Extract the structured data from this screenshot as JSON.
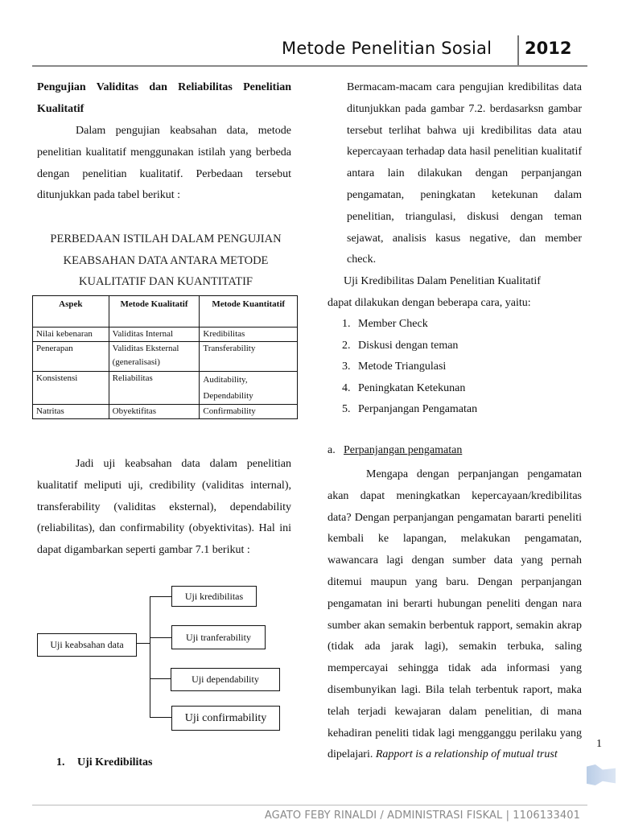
{
  "header": {
    "title": "Metode Penelitian Sosial",
    "year": "2012"
  },
  "left_column": {
    "section_title": "Pengujian Validitas dan Reliabilitas Penelitian Kualitatif",
    "intro_paragraph": "Dalam pengujian keabsahan data, metode penelitian kualitatif menggunakan istilah yang berbeda dengan penelitian kualitatif. Perbedaan tersebut ditunjukkan pada tabel berikut :",
    "table_caption": [
      "PERBEDAAN ISTILAH DALAM PENGUJIAN",
      "KEABSAHAN DATA ANTARA METODE",
      "KUALITATIF DAN KUANTITATIF"
    ],
    "table": {
      "headers": [
        "Aspek",
        "Metode Kualitatif",
        "Metode Kuantitatif"
      ],
      "rows": [
        [
          "Nilai kebenaran",
          "Validitas Internal",
          "Kredibilitas"
        ],
        [
          "Penerapan",
          "Validitas Eksternal (generalisasi)",
          "Transferability"
        ],
        [
          "Konsistensi",
          "Reliabilitas",
          "Auditability, Dependability"
        ],
        [
          "Natritas",
          "Obyektifitas",
          "Confirmability"
        ]
      ]
    },
    "summary_paragraph": "Jadi uji keabsahan data dalam penelitian kualitatif meliputi uji, credibility (validitas internal), transferability (validitas eksternal), dependability (reliabilitas), dan confirmability (obyektivitas). Hal ini dapat digambarkan seperti gambar 7.1 berikut :",
    "diagram": {
      "root": "Uji keabsahan data",
      "children": [
        "Uji kredibilitas",
        "Uji  tranferability",
        "Uji dependability",
        "Uji confirmability"
      ]
    },
    "heading_1": {
      "number": "1.",
      "label": "Uji Kredibilitas"
    }
  },
  "right_column": {
    "paragraph_1": "Bermacam-macam cara pengujian kredibilitas data ditunjukkan pada gambar 7.2. berdasarksn gambar tersebut terlihat bahwa uji kredibilitas data atau kepercayaan terhadap data hasil penelitian kualitatif antara lain dilakukan dengan perpanjangan pengamatan, peningkatan ketekunan dalam penelitian, triangulasi, diskusi dengan teman sejawat, analisis kasus negative, dan member check.",
    "paragraph_2_line1": "Uji Kredibilitas Dalam Penelitian Kualitatif",
    "paragraph_2_line2": "dapat dilakukan dengan  beberapa cara, yaitu:",
    "methods": [
      {
        "n": "1.",
        "label": "Member Check"
      },
      {
        "n": "2.",
        "label": "Diskusi dengan teman"
      },
      {
        "n": "3.",
        "label": "Metode Triangulasi"
      },
      {
        "n": "4.",
        "label": "Peningkatan Ketekunan"
      },
      {
        "n": "5.",
        "label": "Perpanjangan Pengamatan"
      }
    ],
    "subheading_a": {
      "n": "a.",
      "label": "Perpanjangan pengamatan"
    },
    "paragraph_3": "Mengapa dengan perpanjangan pengamatan akan dapat meningkatkan kepercayaan/kredibilitas data? Dengan perpanjangan pengamatan bararti peneliti kembali ke lapangan, melakukan pengamatan, wawancara lagi dengan sumber data yang pernah ditemui maupun yang baru. Dengan perpanjangan pengamatan ini berarti hubungan peneliti dengan nara sumber akan semakin berbentuk rapport, semakin akrap (tidak ada jarak lagi), semakin terbuka, saling mempercayai sehingga tidak ada informasi yang disembunyikan lagi. Bila telah terbentuk raport, maka telah terjadi kewajaran dalam penelitian, di mana kehadiran peneliti tidak lagi mengganggu perilaku yang dipelajari.",
    "paragraph_3_italic": "Rapport is a relationship of mutual trust"
  },
  "page_number": "1",
  "footer": "AGATO FEBY RINALDI / ADMINISTRASI FISKAL | 1106133401"
}
